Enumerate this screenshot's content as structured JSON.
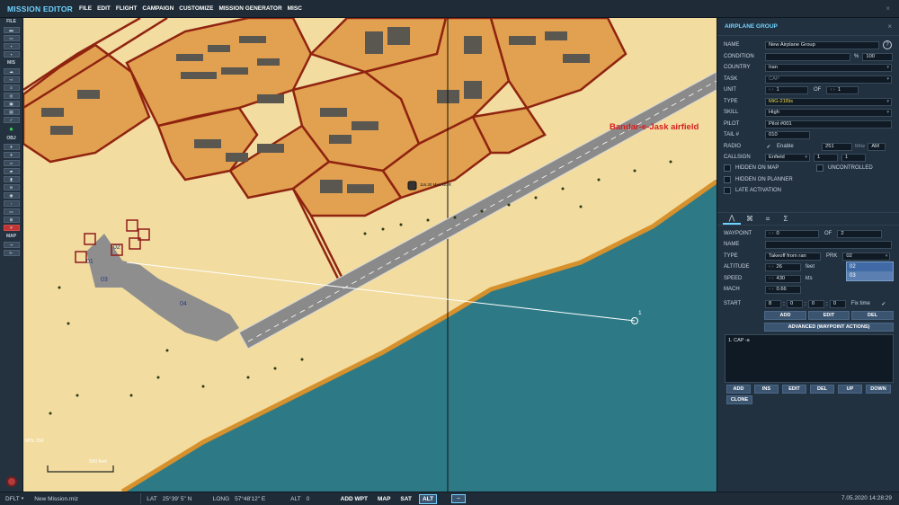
{
  "app": {
    "title": "MISSION EDITOR",
    "close_glyph": "×"
  },
  "menu": [
    "FILE",
    "EDIT",
    "FLIGHT",
    "CAMPAIGN",
    "CUSTOMIZE",
    "MISSION GENERATOR",
    "MISC"
  ],
  "toolbar": {
    "sections": {
      "file": "FILE",
      "mis": "MIS",
      "obj": "OBJ",
      "map": "MAP"
    },
    "file_icons": [
      "new-file-icon",
      "open-file-icon",
      "save-icon",
      "save-as-icon"
    ],
    "mis_icons": [
      "weather-icon",
      "trigger-icon",
      "briefing-icon",
      "goals-icon",
      "settings-icon",
      "options-icon",
      "check-icon"
    ],
    "obj_icons": [
      "airplane-icon",
      "helicopter-icon",
      "ship-icon",
      "ground-unit-icon",
      "static-object-icon",
      "airfield-icon",
      "zone-icon",
      "navpoint-icon",
      "fuel-icon",
      "template-icon",
      "delete-icon"
    ],
    "map_icons": [
      "ruler-icon",
      "route-icon"
    ]
  },
  "map": {
    "title": "Bandar-e-Jask airfield",
    "freq_label": "116.30 MHz BGR",
    "waypoint_label": "1",
    "scale_label": "500 feet",
    "nav_label": "MHz JSK",
    "runway_labels": [
      "01",
      "02",
      "03",
      "04"
    ]
  },
  "panel": {
    "title": "AIRPLANE GROUP",
    "help_glyph": "?",
    "close_glyph": "×",
    "name_label": "NAME",
    "name_value": "New Airplane Group",
    "condition_label": "CONDITION",
    "condition_unit": "%",
    "condition_value": "100",
    "country_label": "COUNTRY",
    "country_value": "Iran",
    "task_label": "TASK",
    "task_value": "CAP",
    "unit_label": "UNIT",
    "unit_value": "1",
    "unit_of": "OF",
    "unit_total": "1",
    "type_label": "TYPE",
    "type_value": "MiG-21Bis",
    "skill_label": "SKILL",
    "skill_value": "High",
    "pilot_label": "PILOT",
    "pilot_value": "Pilot #001",
    "tail_label": "TAIL #",
    "tail_value": "010",
    "radio_label": "RADIO",
    "radio_enable": "Enable",
    "radio_freq": "251",
    "radio_unit": "MHz",
    "radio_mod": "AM",
    "callsign_label": "CALLSIGN",
    "callsign_value": "Enfield",
    "callsign_n1": "1",
    "callsign_n2": "1",
    "checks": {
      "hidden_map": "HIDDEN ON MAP",
      "uncontrolled": "UNCONTROLLED",
      "hidden_planner": "HIDDEN ON PLANNER",
      "late_activation": "LATE ACTIVATION"
    },
    "tabs": [
      "route-tab-icon",
      "payload-tab-icon",
      "triggered-actions-tab-icon",
      "summary-tab-icon"
    ],
    "tab_glyphs": [
      "⋀",
      "⌘",
      "⌗",
      "Σ"
    ],
    "waypoint_label": "WAYPOINT",
    "waypoint_value": "0",
    "waypoint_of": "OF",
    "waypoint_total": "2",
    "wp_name_label": "NAME",
    "wp_name_value": "",
    "wp_type_label": "TYPE",
    "wp_type_value": "Takeoff from ran",
    "prk_label": "PRK",
    "prk_value": "02",
    "prk_options": [
      "02",
      "03"
    ],
    "altitude_label": "ALTITUDE",
    "altitude_value": "26",
    "altitude_unit": "feet",
    "speed_label": "SPEED",
    "speed_value": "430",
    "speed_unit": "kts",
    "mach_label": "MACH",
    "mach_value": "0.66",
    "start_label": "START",
    "start_d": "8",
    "start_h": "0",
    "start_m": "0",
    "start_s": "0",
    "fix_time": "Fix time",
    "btn_add": "ADD",
    "btn_edit": "EDIT",
    "btn_del": "DEL",
    "btn_advanced": "ADVANCED (WAYPOINT ACTIONS)",
    "task_list": [
      "1. CAP -a"
    ],
    "list_buttons": {
      "add": "ADD",
      "ins": "INS",
      "edit": "EDIT",
      "del": "DEL",
      "up": "UP",
      "down": "DOWN",
      "clone": "CLONE"
    }
  },
  "status": {
    "profile": "DFLT",
    "mission_file": "New Mission.miz",
    "lat_label": "LAT",
    "lat_value": "25°39' 5\" N",
    "long_label": "LONG",
    "long_value": "57°48'12\" E",
    "alt_label": "ALT",
    "alt_value": "0",
    "add_wpt": "ADD WPT",
    "map_btn": "MAP",
    "sat_btn": "SAT",
    "alt_btn": "ALT",
    "datetime": "7.05.2020 14:28:29"
  },
  "colors": {
    "accent": "#6fd3ff",
    "sea": "#2d7a86",
    "sand": "#f2dca0",
    "urban": "#e2a150",
    "border_red": "#9a2412",
    "title_red": "#d61f1f"
  }
}
